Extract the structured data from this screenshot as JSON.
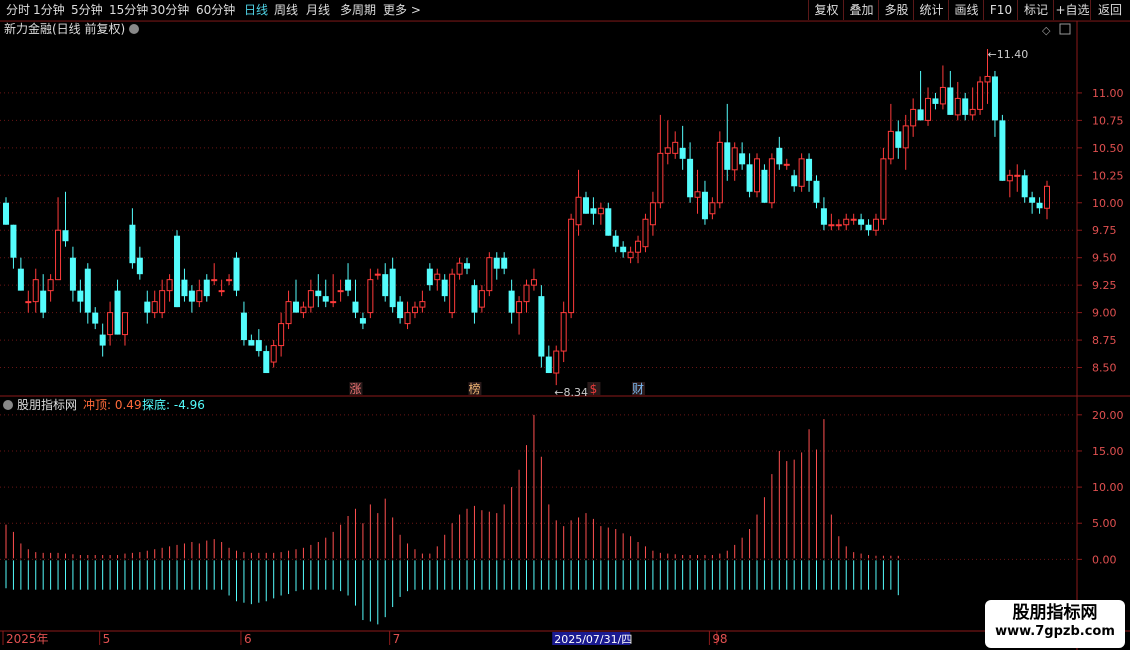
{
  "toolbar": {
    "periods": [
      "分时",
      "1分钟",
      "5分钟",
      "15分钟",
      "30分钟",
      "60分钟",
      "日线",
      "周线",
      "月线",
      "多周期",
      "更多 >"
    ],
    "active_period": "日线",
    "actions": [
      "复权",
      "叠加",
      "多股",
      "统计",
      "画线",
      "F10",
      "标记",
      "+自选",
      "返回"
    ]
  },
  "main_panel": {
    "title": "新力金融(日线 前复权)",
    "high_label": "11.40",
    "low_label": "8.34",
    "event_markers": [
      {
        "text": "涨",
        "index": 47,
        "color": "#e87070"
      },
      {
        "text": "榜",
        "index": 63,
        "color": "#e8b070"
      },
      {
        "text": "$",
        "index": 79,
        "color": "#e83a3a"
      },
      {
        "text": "财",
        "index": 85,
        "color": "#7ab8f0"
      }
    ]
  },
  "sub_panel": {
    "title": "股朋指标网",
    "chongding_label": "冲顶:",
    "chongding_value": "0.49",
    "tandi_label": "探底:",
    "tandi_value": "-4.96"
  },
  "time_axis": {
    "labels": [
      {
        "text": "2025年",
        "index": 0
      },
      {
        "text": "5",
        "index": 13
      },
      {
        "text": "6",
        "index": 32
      },
      {
        "text": "7",
        "index": 52
      },
      {
        "text": "8",
        "index": 96
      },
      {
        "text": "9",
        "index": 95
      }
    ],
    "highlight": "2025/07/31/四",
    "highlight_index": 74
  },
  "watermark": {
    "line1": "股朋指标网",
    "line2": "www.7gpzb.com"
  },
  "colors": {
    "up": "#ff3b3b",
    "down": "#54fcfc",
    "axis": "#8b1a1a",
    "grid": "#6a1515",
    "label": "#e05050"
  },
  "chart_data": {
    "type": "candlestick",
    "price_axis": {
      "ticks": [
        8.5,
        8.75,
        9.0,
        9.25,
        9.5,
        9.75,
        10.0,
        10.25,
        10.5,
        10.75,
        11.0
      ],
      "ylim": [
        8.25,
        11.5
      ]
    },
    "ohlc": [
      [
        10.0,
        10.05,
        9.8,
        9.8
      ],
      [
        9.8,
        9.8,
        9.4,
        9.5
      ],
      [
        9.4,
        9.5,
        9.2,
        9.2
      ],
      [
        9.1,
        9.2,
        9.0,
        9.1
      ],
      [
        9.1,
        9.4,
        9.0,
        9.3
      ],
      [
        9.2,
        9.35,
        8.95,
        9.0
      ],
      [
        9.2,
        9.35,
        9.1,
        9.3
      ],
      [
        9.3,
        10.05,
        9.3,
        9.75
      ],
      [
        9.75,
        10.1,
        9.6,
        9.65
      ],
      [
        9.5,
        9.6,
        9.1,
        9.2
      ],
      [
        9.2,
        9.3,
        9.0,
        9.1
      ],
      [
        9.4,
        9.45,
        8.9,
        9.0
      ],
      [
        9.0,
        9.05,
        8.85,
        8.9
      ],
      [
        8.8,
        8.9,
        8.6,
        8.7
      ],
      [
        8.8,
        9.1,
        8.7,
        9.0
      ],
      [
        9.2,
        9.3,
        8.8,
        8.8
      ],
      [
        8.8,
        9.0,
        8.7,
        9.0
      ],
      [
        9.8,
        9.95,
        9.4,
        9.45
      ],
      [
        9.5,
        9.6,
        9.3,
        9.35
      ],
      [
        9.1,
        9.2,
        8.9,
        9.0
      ],
      [
        9.0,
        9.2,
        8.95,
        9.1
      ],
      [
        9.0,
        9.3,
        8.95,
        9.2
      ],
      [
        9.2,
        9.35,
        9.1,
        9.3
      ],
      [
        9.7,
        9.75,
        9.05,
        9.05
      ],
      [
        9.3,
        9.4,
        9.1,
        9.15
      ],
      [
        9.2,
        9.25,
        9.0,
        9.1
      ],
      [
        9.1,
        9.3,
        9.05,
        9.2
      ],
      [
        9.3,
        9.35,
        9.1,
        9.15
      ],
      [
        9.3,
        9.45,
        9.25,
        9.3
      ],
      [
        9.2,
        9.3,
        9.15,
        9.2
      ],
      [
        9.3,
        9.35,
        9.25,
        9.3
      ],
      [
        9.5,
        9.55,
        9.15,
        9.2
      ],
      [
        9.0,
        9.1,
        8.7,
        8.75
      ],
      [
        8.75,
        8.8,
        8.7,
        8.7
      ],
      [
        8.75,
        8.85,
        8.6,
        8.65
      ],
      [
        8.65,
        8.7,
        8.45,
        8.45
      ],
      [
        8.55,
        8.75,
        8.5,
        8.7
      ],
      [
        8.7,
        9.0,
        8.6,
        8.9
      ],
      [
        8.9,
        9.2,
        8.85,
        9.1
      ],
      [
        9.1,
        9.3,
        9.0,
        9.0
      ],
      [
        9.0,
        9.1,
        8.95,
        9.05
      ],
      [
        9.05,
        9.3,
        9.0,
        9.2
      ],
      [
        9.2,
        9.35,
        9.05,
        9.15
      ],
      [
        9.15,
        9.3,
        9.05,
        9.1
      ],
      [
        9.1,
        9.35,
        9.05,
        9.1
      ],
      [
        9.2,
        9.3,
        9.1,
        9.2
      ],
      [
        9.3,
        9.45,
        9.15,
        9.2
      ],
      [
        9.1,
        9.3,
        8.95,
        9.0
      ],
      [
        8.95,
        9.0,
        8.85,
        8.9
      ],
      [
        9.0,
        9.4,
        8.95,
        9.3
      ],
      [
        9.35,
        9.4,
        9.3,
        9.35
      ],
      [
        9.35,
        9.45,
        9.1,
        9.15
      ],
      [
        9.4,
        9.5,
        9.0,
        9.05
      ],
      [
        9.1,
        9.15,
        8.9,
        8.95
      ],
      [
        8.9,
        9.1,
        8.85,
        9.0
      ],
      [
        9.0,
        9.1,
        8.95,
        9.05
      ],
      [
        9.05,
        9.2,
        9.0,
        9.1
      ],
      [
        9.4,
        9.45,
        9.2,
        9.25
      ],
      [
        9.3,
        9.4,
        9.2,
        9.35
      ],
      [
        9.3,
        9.35,
        9.1,
        9.15
      ],
      [
        9.0,
        9.4,
        8.95,
        9.35
      ],
      [
        9.35,
        9.5,
        9.3,
        9.45
      ],
      [
        9.45,
        9.5,
        9.35,
        9.4
      ],
      [
        9.25,
        9.3,
        8.9,
        9.0
      ],
      [
        9.05,
        9.25,
        9.0,
        9.2
      ],
      [
        9.2,
        9.55,
        9.15,
        9.5
      ],
      [
        9.5,
        9.55,
        9.3,
        9.4
      ],
      [
        9.5,
        9.55,
        9.35,
        9.4
      ],
      [
        9.2,
        9.3,
        8.9,
        9.0
      ],
      [
        9.0,
        9.15,
        8.8,
        9.1
      ],
      [
        9.1,
        9.3,
        9.0,
        9.25
      ],
      [
        9.25,
        9.4,
        9.2,
        9.3
      ],
      [
        9.15,
        9.25,
        8.5,
        8.6
      ],
      [
        8.6,
        8.7,
        8.45,
        8.45
      ],
      [
        8.45,
        8.7,
        8.34,
        8.65
      ],
      [
        8.65,
        9.1,
        8.55,
        9.0
      ],
      [
        9.0,
        9.9,
        8.95,
        9.85
      ],
      [
        9.8,
        10.3,
        9.7,
        10.05
      ],
      [
        10.05,
        10.1,
        9.9,
        9.9
      ],
      [
        9.95,
        10.05,
        9.8,
        9.9
      ],
      [
        9.9,
        10.0,
        9.8,
        9.95
      ],
      [
        9.95,
        10.0,
        9.7,
        9.7
      ],
      [
        9.7,
        9.75,
        9.55,
        9.6
      ],
      [
        9.6,
        9.65,
        9.5,
        9.55
      ],
      [
        9.5,
        9.6,
        9.45,
        9.55
      ],
      [
        9.55,
        9.7,
        9.45,
        9.65
      ],
      [
        9.6,
        9.9,
        9.55,
        9.85
      ],
      [
        9.8,
        10.1,
        9.7,
        10.0
      ],
      [
        10.0,
        10.8,
        9.95,
        10.45
      ],
      [
        10.45,
        10.75,
        10.35,
        10.5
      ],
      [
        10.45,
        10.65,
        10.4,
        10.55
      ],
      [
        10.5,
        10.7,
        10.3,
        10.4
      ],
      [
        10.4,
        10.55,
        10.0,
        10.05
      ],
      [
        10.05,
        10.3,
        9.9,
        10.1
      ],
      [
        10.1,
        10.2,
        9.8,
        9.85
      ],
      [
        9.9,
        10.05,
        9.85,
        10.0
      ],
      [
        10.0,
        10.65,
        9.95,
        10.55
      ],
      [
        10.55,
        10.9,
        10.2,
        10.3
      ],
      [
        10.3,
        10.55,
        10.2,
        10.5
      ],
      [
        10.45,
        10.55,
        10.3,
        10.35
      ],
      [
        10.35,
        10.45,
        10.05,
        10.1
      ],
      [
        10.1,
        10.45,
        10.05,
        10.4
      ],
      [
        10.3,
        10.35,
        10.0,
        10.0
      ],
      [
        10.0,
        10.45,
        9.95,
        10.4
      ],
      [
        10.5,
        10.6,
        10.3,
        10.35
      ],
      [
        10.35,
        10.4,
        10.3,
        10.35
      ],
      [
        10.25,
        10.3,
        10.1,
        10.15
      ],
      [
        10.15,
        10.45,
        10.1,
        10.4
      ],
      [
        10.4,
        10.45,
        10.1,
        10.2
      ],
      [
        10.2,
        10.25,
        9.95,
        10.0
      ],
      [
        9.95,
        10.05,
        9.75,
        9.8
      ],
      [
        9.8,
        9.9,
        9.75,
        9.8
      ],
      [
        9.8,
        9.85,
        9.75,
        9.8
      ],
      [
        9.8,
        9.9,
        9.75,
        9.85
      ],
      [
        9.85,
        9.9,
        9.8,
        9.85
      ],
      [
        9.85,
        9.9,
        9.75,
        9.8
      ],
      [
        9.8,
        9.85,
        9.7,
        9.75
      ],
      [
        9.75,
        9.9,
        9.7,
        9.85
      ],
      [
        9.85,
        10.5,
        9.8,
        10.4
      ],
      [
        10.4,
        10.9,
        10.35,
        10.65
      ],
      [
        10.65,
        10.75,
        10.4,
        10.5
      ],
      [
        10.5,
        10.8,
        10.3,
        10.7
      ],
      [
        10.7,
        10.95,
        10.6,
        10.85
      ],
      [
        10.85,
        11.2,
        10.75,
        10.75
      ],
      [
        10.75,
        11.05,
        10.7,
        10.95
      ],
      [
        10.95,
        11.0,
        10.85,
        10.9
      ],
      [
        10.9,
        11.25,
        10.85,
        11.05
      ],
      [
        11.05,
        11.2,
        10.8,
        10.8
      ],
      [
        10.8,
        11.1,
        10.75,
        10.95
      ],
      [
        10.95,
        11.0,
        10.75,
        10.8
      ],
      [
        10.8,
        11.05,
        10.75,
        10.85
      ],
      [
        10.85,
        11.15,
        10.8,
        11.1
      ],
      [
        11.1,
        11.4,
        10.9,
        11.15
      ],
      [
        11.15,
        11.2,
        10.6,
        10.75
      ],
      [
        10.75,
        10.8,
        10.2,
        10.2
      ],
      [
        10.2,
        10.3,
        10.05,
        10.25
      ],
      [
        10.25,
        10.35,
        10.1,
        10.25
      ],
      [
        10.25,
        10.3,
        10.0,
        10.05
      ],
      [
        10.05,
        10.1,
        9.9,
        10.0
      ],
      [
        10.0,
        10.05,
        9.9,
        9.95
      ],
      [
        9.95,
        10.2,
        9.85,
        10.15
      ]
    ],
    "indicator": {
      "chongding_series": [
        4.8,
        3.8,
        2.2,
        1.4,
        1.0,
        0.9,
        0.9,
        0.9,
        0.8,
        0.7,
        0.6,
        0.6,
        0.6,
        0.6,
        0.6,
        0.6,
        0.8,
        0.9,
        1.0,
        1.2,
        1.4,
        1.6,
        1.8,
        2.0,
        2.2,
        2.4,
        2.2,
        2.6,
        2.8,
        2.4,
        1.6,
        1.2,
        1.0,
        0.9,
        0.9,
        0.9,
        0.9,
        1.0,
        1.2,
        1.4,
        1.6,
        2.0,
        2.4,
        3.0,
        3.8,
        4.8,
        6.0,
        7.0,
        5.0,
        7.6,
        6.4,
        8.4,
        5.8,
        3.4,
        2.2,
        1.4,
        0.8,
        0.8,
        1.8,
        3.4,
        5.0,
        6.2,
        7.0,
        7.4,
        6.8,
        6.6,
        6.4,
        7.6,
        10.0,
        12.4,
        15.8,
        20.0,
        14.2,
        7.6,
        5.4,
        4.6,
        5.4,
        5.8,
        6.4,
        5.6,
        4.6,
        4.4,
        4.2,
        3.6,
        3.2,
        2.4,
        1.8,
        1.2,
        0.9,
        0.8,
        0.7,
        0.6,
        0.6,
        0.6,
        0.6,
        0.6,
        0.8,
        1.2,
        2.0,
        3.0,
        4.2,
        6.2,
        8.6,
        11.8,
        15.0,
        13.6,
        13.8,
        14.8,
        18.0,
        15.2,
        19.4,
        6.2,
        3.2,
        1.8,
        1.0,
        0.8,
        0.6,
        0.5,
        0.5,
        0.5,
        0.49
      ],
      "tandi_series": [
        -4.0,
        -4.2,
        -4.2,
        -4.2,
        -4.2,
        -4.2,
        -4.2,
        -4.2,
        -4.2,
        -4.2,
        -4.2,
        -4.2,
        -4.2,
        -4.2,
        -4.2,
        -4.2,
        -4.2,
        -4.2,
        -4.2,
        -4.2,
        -4.2,
        -4.2,
        -4.2,
        -4.2,
        -4.2,
        -4.2,
        -4.2,
        -4.2,
        -4.2,
        -4.2,
        -5.0,
        -5.8,
        -6.0,
        -6.2,
        -6.0,
        -5.8,
        -5.4,
        -5.0,
        -4.8,
        -4.4,
        -4.2,
        -4.2,
        -4.2,
        -4.2,
        -4.2,
        -4.4,
        -5.0,
        -6.4,
        -8.4,
        -8.6,
        -9.0,
        -8.0,
        -6.6,
        -5.2,
        -4.4,
        -4.2,
        -4.2,
        -4.2,
        -4.2,
        -4.2,
        -4.2,
        -4.2,
        -4.2,
        -4.2,
        -4.2,
        -4.2,
        -4.2,
        -4.2,
        -4.2,
        -4.2,
        -4.2,
        -4.2,
        -4.2,
        -4.2,
        -4.2,
        -4.2,
        -4.2,
        -4.2,
        -4.2,
        -4.2,
        -4.2,
        -4.2,
        -4.2,
        -4.2,
        -4.2,
        -4.2,
        -4.2,
        -4.2,
        -4.2,
        -4.2,
        -4.2,
        -4.2,
        -4.2,
        -4.2,
        -4.2,
        -4.2,
        -4.2,
        -4.2,
        -4.2,
        -4.2,
        -4.2,
        -4.2,
        -4.2,
        -4.2,
        -4.2,
        -4.2,
        -4.2,
        -4.2,
        -4.2,
        -4.2,
        -4.2,
        -4.2,
        -4.2,
        -4.2,
        -4.2,
        -4.2,
        -4.2,
        -4.2,
        -4.2,
        -4.2,
        -4.96
      ],
      "ticks": [
        0.0,
        5.0,
        10.0,
        15.0,
        20.0
      ],
      "ylim": [
        -9.5,
        21.5
      ]
    }
  }
}
